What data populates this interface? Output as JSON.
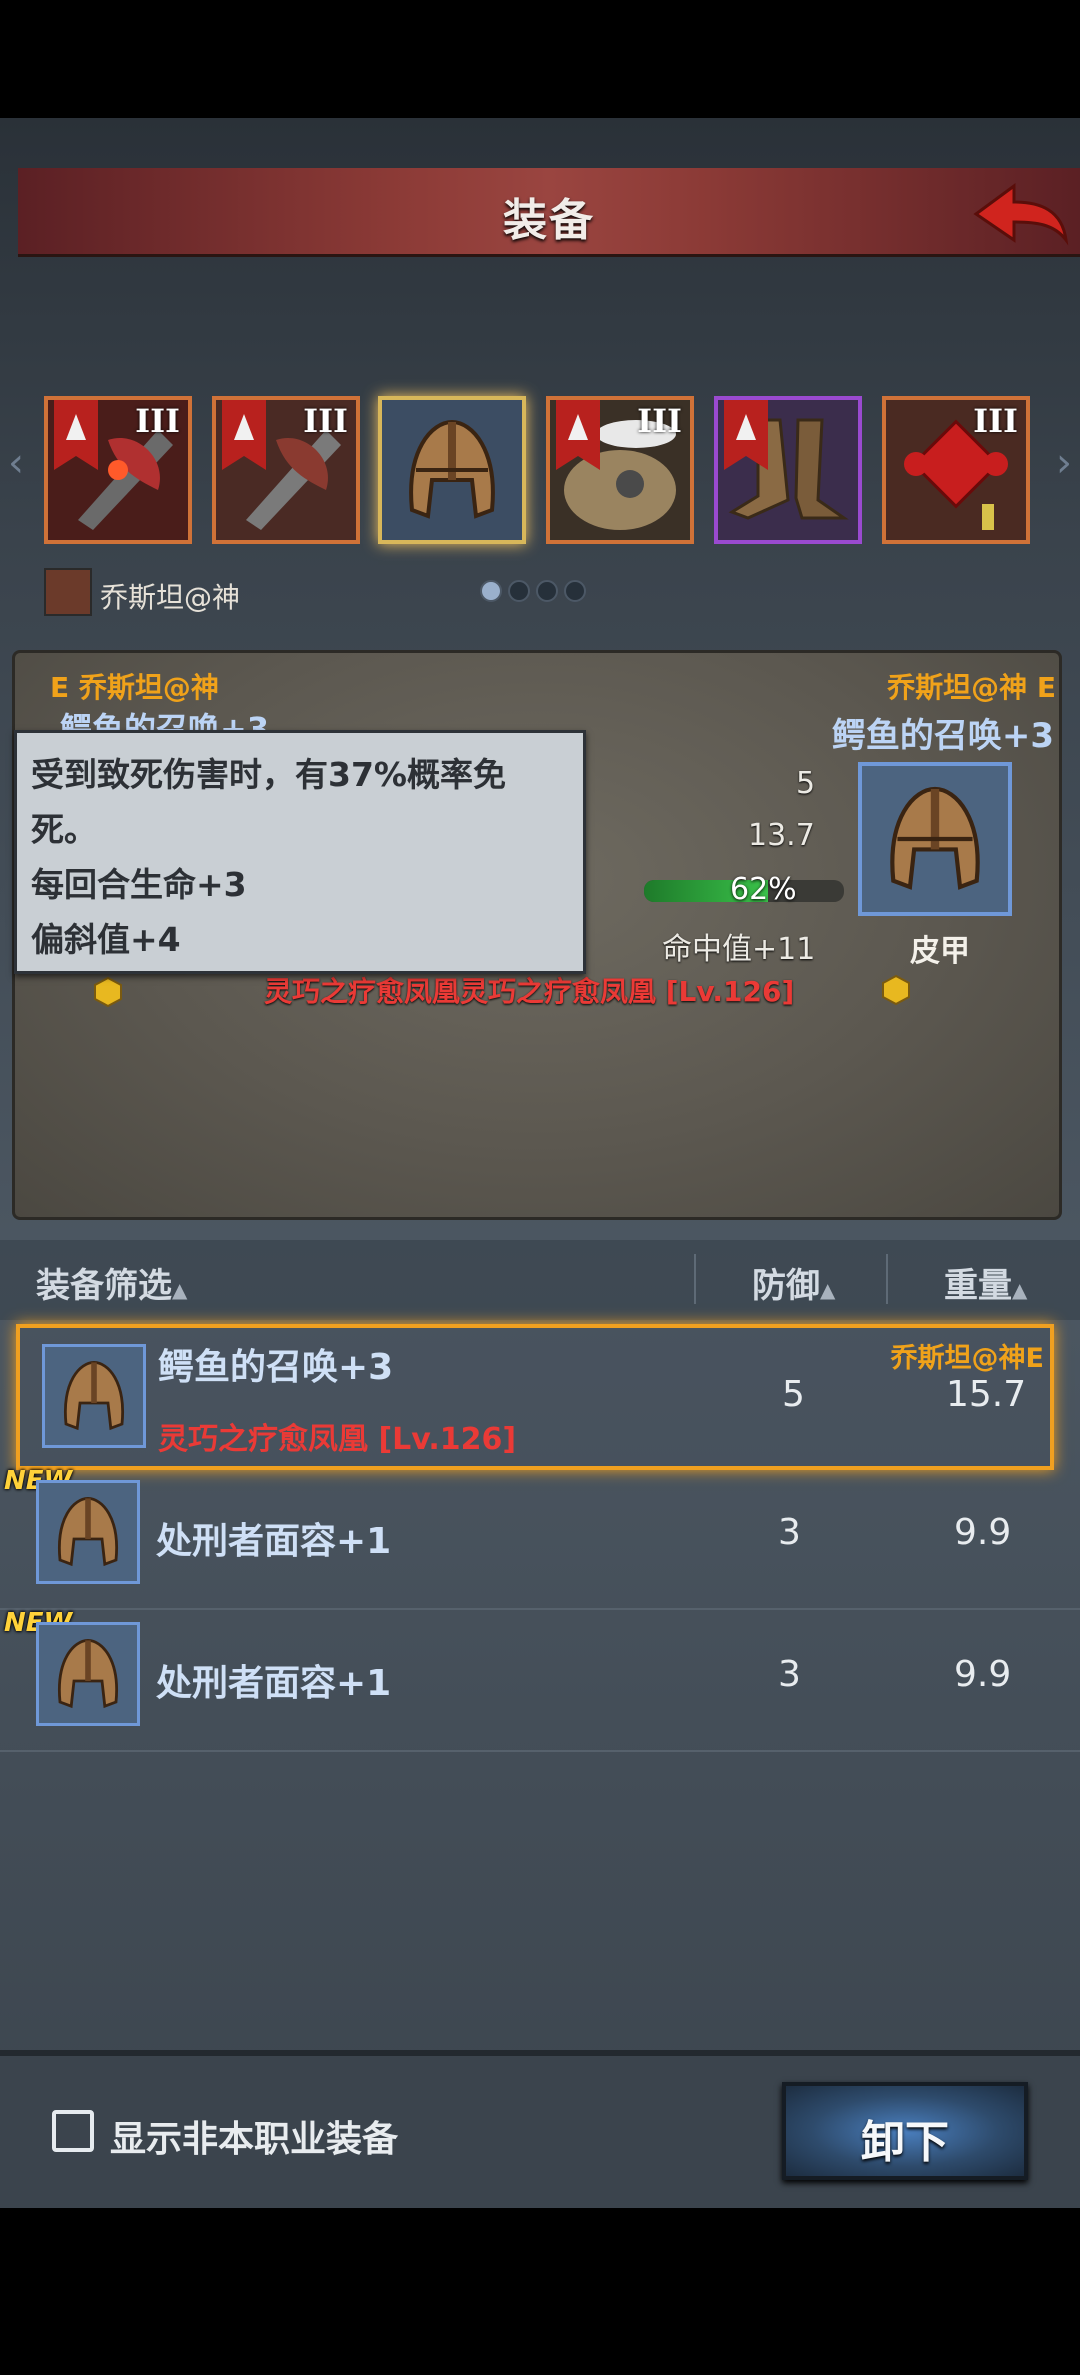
{
  "header": {
    "title": "装备"
  },
  "slots": [
    {
      "rank": "III",
      "type": "weapon",
      "selected": false
    },
    {
      "rank": "III",
      "type": "weapon",
      "selected": false
    },
    {
      "rank": "",
      "type": "helmet",
      "selected": true
    },
    {
      "rank": "III",
      "type": "armor",
      "selected": false
    },
    {
      "rank": "",
      "type": "boots",
      "selected": false
    },
    {
      "rank": "III",
      "type": "charm",
      "selected": false
    }
  ],
  "owner": {
    "name": "乔斯坦@神"
  },
  "pager": {
    "pages": 4,
    "active": 1
  },
  "compare": {
    "left_owner": "E 乔斯坦@神",
    "left_name": "鳄鱼的召唤+3",
    "right_owner": "乔斯坦@神 E",
    "right_name": "鳄鱼的召唤+3",
    "defense": "5",
    "weight": "13.7",
    "durability": "62%",
    "durability_value": 0.62,
    "hit": "命中值+11",
    "type": "皮甲",
    "set_text": "灵巧之疗愈凤凰灵巧之疗愈凤凰 [Lv.126]"
  },
  "tooltip": {
    "line1": "受到致死伤害时，有37%概率免",
    "line2": "死。",
    "line3": "每回合生命+3",
    "line4": "偏斜值+4"
  },
  "list_header": {
    "filter": "装备筛选",
    "defense": "防御",
    "weight": "重量"
  },
  "items": [
    {
      "name": "鳄鱼的召唤+3",
      "set": "灵巧之疗愈凤凰 [Lv.126]",
      "owner": "乔斯坦@神E",
      "defense": "5",
      "weight": "15.7",
      "new": ""
    },
    {
      "name": "处刑者面容+1",
      "set": "",
      "owner": "",
      "defense": "3",
      "weight": "9.9",
      "new": "NEW"
    },
    {
      "name": "处刑者面容+1",
      "set": "",
      "owner": "",
      "defense": "3",
      "weight": "9.9",
      "new": "NEW"
    }
  ],
  "bottom": {
    "show_other_class": "显示非本职业装备",
    "unequip": "卸下"
  },
  "colors": {
    "accent_orange": "#f0a21a",
    "set_red": "#ea3a36",
    "name_blue": "#cfe0f6"
  }
}
